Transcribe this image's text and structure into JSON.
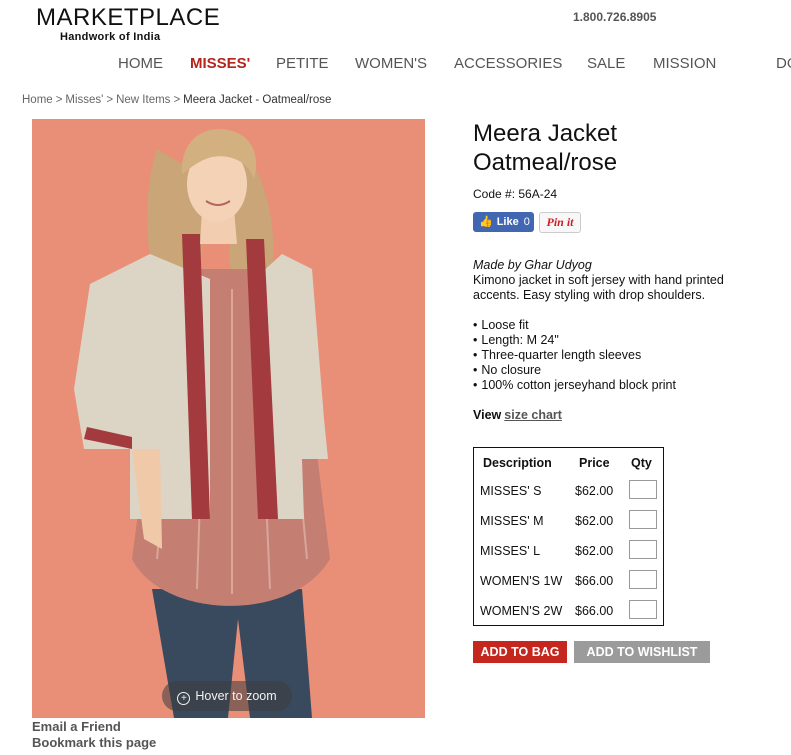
{
  "header": {
    "logo_title": "MARKETPLACE",
    "logo_subtitle": "Handwork of India",
    "phone": "1.800.726.8905"
  },
  "nav": {
    "items": [
      "HOME",
      "MISSES'",
      "PETITE",
      "WOMEN'S",
      "ACCESSORIES",
      "SALE",
      "MISSION",
      "DO"
    ],
    "active_index": 1
  },
  "breadcrumb": {
    "items": [
      "Home",
      "Misses'",
      "New Items"
    ],
    "separator": ">",
    "current": "Meera Jacket - Oatmeal/rose"
  },
  "image": {
    "zoom_hint": "Hover to zoom",
    "email_friend": "Email a Friend",
    "bookmark": "Bookmark this page"
  },
  "product": {
    "title_line1": "Meera Jacket",
    "title_line2": "Oatmeal/rose",
    "code_label": "Code #:",
    "code_value": "56A-24",
    "made_by": "Made by Ghar Udyog",
    "description_line1": "Kimono jacket in soft jersey with hand printed",
    "description_line2": "accents. Easy styling with drop shoulders.",
    "features": [
      "Loose fit",
      "Length: M 24\"",
      "Three-quarter length sleeves",
      "No closure",
      "100% cotton jerseyhand block print"
    ],
    "size_chart_prefix": "View",
    "size_chart_link": "size chart"
  },
  "social": {
    "like_label": "Like",
    "like_count": "0",
    "pin_label": "Pin it"
  },
  "price_table": {
    "headers": [
      "Description",
      "Price",
      "Qty"
    ],
    "rows": [
      {
        "description": "MISSES' S",
        "price": "$62.00"
      },
      {
        "description": "MISSES' M",
        "price": "$62.00"
      },
      {
        "description": "MISSES' L",
        "price": "$62.00"
      },
      {
        "description": "WOMEN'S 1W",
        "price": "$66.00"
      },
      {
        "description": "WOMEN'S 2W",
        "price": "$66.00"
      }
    ]
  },
  "actions": {
    "add_to_bag": "ADD TO BAG",
    "add_to_wishlist": "ADD TO WISHLIST"
  },
  "colors": {
    "brand_red": "#c5261e",
    "nav_active": "#b5241d",
    "wishlist_grey": "#9b9b9b",
    "facebook_blue": "#4267b2",
    "photo_background": "#e98f78"
  },
  "icons": {
    "zoom": "zoom-plus-icon",
    "like": "thumbs-up-icon"
  }
}
